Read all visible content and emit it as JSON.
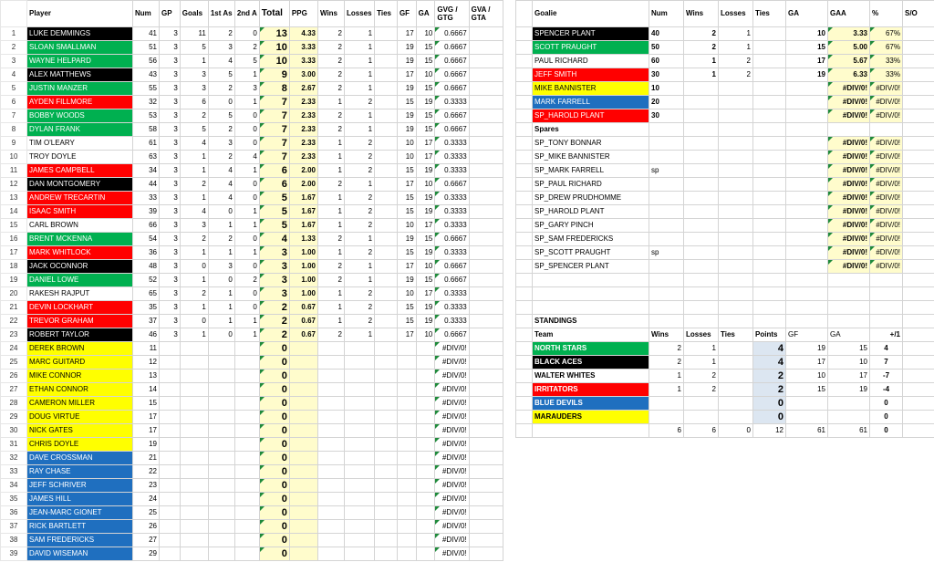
{
  "players": {
    "headers": [
      "Player",
      "Num",
      "GP",
      "Goals",
      "1st As",
      "2nd A",
      "Total",
      "PPG",
      "Wins",
      "Losses",
      "Ties",
      "GF",
      "GA",
      "GVG / GTG",
      "GVA / GTA"
    ],
    "rows": [
      {
        "n": "1",
        "name": "LUKE DEMMINGS",
        "team": "black",
        "num": "41",
        "gp": "3",
        "g": "11",
        "a1": "2",
        "a2": "0",
        "t": "13",
        "ppg": "4.33",
        "w": "2",
        "l": "1",
        "ti": "",
        "gf": "17",
        "ga": "10",
        "gvg": "0.6667"
      },
      {
        "n": "2",
        "name": "SLOAN SMALLMAN",
        "team": "green",
        "num": "51",
        "gp": "3",
        "g": "5",
        "a1": "3",
        "a2": "2",
        "t": "10",
        "ppg": "3.33",
        "w": "2",
        "l": "1",
        "ti": "",
        "gf": "19",
        "ga": "15",
        "gvg": "0.6667"
      },
      {
        "n": "3",
        "name": "WAYNE HELPARD",
        "team": "green",
        "num": "56",
        "gp": "3",
        "g": "1",
        "a1": "4",
        "a2": "5",
        "t": "10",
        "ppg": "3.33",
        "w": "2",
        "l": "1",
        "ti": "",
        "gf": "19",
        "ga": "15",
        "gvg": "0.6667"
      },
      {
        "n": "4",
        "name": "ALEX MATTHEWS",
        "team": "black",
        "num": "43",
        "gp": "3",
        "g": "3",
        "a1": "5",
        "a2": "1",
        "t": "9",
        "ppg": "3.00",
        "w": "2",
        "l": "1",
        "ti": "",
        "gf": "17",
        "ga": "10",
        "gvg": "0.6667"
      },
      {
        "n": "5",
        "name": "JUSTIN MANZER",
        "team": "green",
        "num": "55",
        "gp": "3",
        "g": "3",
        "a1": "2",
        "a2": "3",
        "t": "8",
        "ppg": "2.67",
        "w": "2",
        "l": "1",
        "ti": "",
        "gf": "19",
        "ga": "15",
        "gvg": "0.6667"
      },
      {
        "n": "6",
        "name": "AYDEN FILLMORE",
        "team": "red",
        "num": "32",
        "gp": "3",
        "g": "6",
        "a1": "0",
        "a2": "1",
        "t": "7",
        "ppg": "2.33",
        "w": "1",
        "l": "2",
        "ti": "",
        "gf": "15",
        "ga": "19",
        "gvg": "0.3333"
      },
      {
        "n": "7",
        "name": "BOBBY WOODS",
        "team": "green",
        "num": "53",
        "gp": "3",
        "g": "2",
        "a1": "5",
        "a2": "0",
        "t": "7",
        "ppg": "2.33",
        "w": "2",
        "l": "1",
        "ti": "",
        "gf": "19",
        "ga": "15",
        "gvg": "0.6667"
      },
      {
        "n": "8",
        "name": "DYLAN FRANK",
        "team": "green",
        "num": "58",
        "gp": "3",
        "g": "5",
        "a1": "2",
        "a2": "0",
        "t": "7",
        "ppg": "2.33",
        "w": "2",
        "l": "1",
        "ti": "",
        "gf": "19",
        "ga": "15",
        "gvg": "0.6667"
      },
      {
        "n": "9",
        "name": "TIM O'LEARY",
        "team": "white",
        "num": "61",
        "gp": "3",
        "g": "4",
        "a1": "3",
        "a2": "0",
        "t": "7",
        "ppg": "2.33",
        "w": "1",
        "l": "2",
        "ti": "",
        "gf": "10",
        "ga": "17",
        "gvg": "0.3333"
      },
      {
        "n": "10",
        "name": "TROY DOYLE",
        "team": "white",
        "num": "63",
        "gp": "3",
        "g": "1",
        "a1": "2",
        "a2": "4",
        "t": "7",
        "ppg": "2.33",
        "w": "1",
        "l": "2",
        "ti": "",
        "gf": "10",
        "ga": "17",
        "gvg": "0.3333"
      },
      {
        "n": "11",
        "name": "JAMES CAMPBELL",
        "team": "red",
        "num": "34",
        "gp": "3",
        "g": "1",
        "a1": "4",
        "a2": "1",
        "t": "6",
        "ppg": "2.00",
        "w": "1",
        "l": "2",
        "ti": "",
        "gf": "15",
        "ga": "19",
        "gvg": "0.3333"
      },
      {
        "n": "12",
        "name": "DAN MONTGOMERY",
        "team": "black",
        "num": "44",
        "gp": "3",
        "g": "2",
        "a1": "4",
        "a2": "0",
        "t": "6",
        "ppg": "2.00",
        "w": "2",
        "l": "1",
        "ti": "",
        "gf": "17",
        "ga": "10",
        "gvg": "0.6667"
      },
      {
        "n": "13",
        "name": "ANDREW TRECARTIN",
        "team": "red",
        "num": "33",
        "gp": "3",
        "g": "1",
        "a1": "4",
        "a2": "0",
        "t": "5",
        "ppg": "1.67",
        "w": "1",
        "l": "2",
        "ti": "",
        "gf": "15",
        "ga": "19",
        "gvg": "0.3333"
      },
      {
        "n": "14",
        "name": "ISAAC SMITH",
        "team": "red",
        "num": "39",
        "gp": "3",
        "g": "4",
        "a1": "0",
        "a2": "1",
        "t": "5",
        "ppg": "1.67",
        "w": "1",
        "l": "2",
        "ti": "",
        "gf": "15",
        "ga": "19",
        "gvg": "0.3333"
      },
      {
        "n": "15",
        "name": "CARL BROWN",
        "team": "white",
        "num": "66",
        "gp": "3",
        "g": "3",
        "a1": "1",
        "a2": "1",
        "t": "5",
        "ppg": "1.67",
        "w": "1",
        "l": "2",
        "ti": "",
        "gf": "10",
        "ga": "17",
        "gvg": "0.3333"
      },
      {
        "n": "16",
        "name": "BRENT MCKENNA",
        "team": "green",
        "num": "54",
        "gp": "3",
        "g": "2",
        "a1": "2",
        "a2": "0",
        "t": "4",
        "ppg": "1.33",
        "w": "2",
        "l": "1",
        "ti": "",
        "gf": "19",
        "ga": "15",
        "gvg": "0.6667"
      },
      {
        "n": "17",
        "name": "MARK WHITLOCK",
        "team": "red",
        "num": "36",
        "gp": "3",
        "g": "1",
        "a1": "1",
        "a2": "1",
        "t": "3",
        "ppg": "1.00",
        "w": "1",
        "l": "2",
        "ti": "",
        "gf": "15",
        "ga": "19",
        "gvg": "0.3333"
      },
      {
        "n": "18",
        "name": "JACK OCONNOR",
        "team": "black",
        "num": "48",
        "gp": "3",
        "g": "0",
        "a1": "3",
        "a2": "0",
        "t": "3",
        "ppg": "1.00",
        "w": "2",
        "l": "1",
        "ti": "",
        "gf": "17",
        "ga": "10",
        "gvg": "0.6667"
      },
      {
        "n": "19",
        "name": "DANIEL LOWE",
        "team": "green",
        "num": "52",
        "gp": "3",
        "g": "1",
        "a1": "0",
        "a2": "2",
        "t": "3",
        "ppg": "1.00",
        "w": "2",
        "l": "1",
        "ti": "",
        "gf": "19",
        "ga": "15",
        "gvg": "0.6667"
      },
      {
        "n": "20",
        "name": "RAKESH RAJPUT",
        "team": "white",
        "num": "65",
        "gp": "3",
        "g": "2",
        "a1": "1",
        "a2": "0",
        "t": "3",
        "ppg": "1.00",
        "w": "1",
        "l": "2",
        "ti": "",
        "gf": "10",
        "ga": "17",
        "gvg": "0.3333"
      },
      {
        "n": "21",
        "name": "DEVIN LOCKHART",
        "team": "red",
        "num": "35",
        "gp": "3",
        "g": "1",
        "a1": "1",
        "a2": "0",
        "t": "2",
        "ppg": "0.67",
        "w": "1",
        "l": "2",
        "ti": "",
        "gf": "15",
        "ga": "19",
        "gvg": "0.3333"
      },
      {
        "n": "22",
        "name": "TREVOR GRAHAM",
        "team": "red",
        "num": "37",
        "gp": "3",
        "g": "0",
        "a1": "1",
        "a2": "1",
        "t": "2",
        "ppg": "0.67",
        "w": "1",
        "l": "2",
        "ti": "",
        "gf": "15",
        "ga": "19",
        "gvg": "0.3333"
      },
      {
        "n": "23",
        "name": "ROBERT TAYLOR",
        "team": "black",
        "num": "46",
        "gp": "3",
        "g": "1",
        "a1": "0",
        "a2": "1",
        "t": "2",
        "ppg": "0.67",
        "w": "2",
        "l": "1",
        "ti": "",
        "gf": "17",
        "ga": "10",
        "gvg": "0.6667"
      },
      {
        "n": "24",
        "name": "DEREK BROWN",
        "team": "yellow",
        "num": "11",
        "gp": "",
        "g": "",
        "a1": "",
        "a2": "",
        "t": "0",
        "ppg": "",
        "w": "",
        "l": "",
        "ti": "",
        "gf": "",
        "ga": "",
        "gvg": "#DIV/0!"
      },
      {
        "n": "25",
        "name": "MARC GUITARD",
        "team": "yellow",
        "num": "12",
        "gp": "",
        "g": "",
        "a1": "",
        "a2": "",
        "t": "0",
        "ppg": "",
        "w": "",
        "l": "",
        "ti": "",
        "gf": "",
        "ga": "",
        "gvg": "#DIV/0!"
      },
      {
        "n": "26",
        "name": "MIKE CONNOR",
        "team": "yellow",
        "num": "13",
        "gp": "",
        "g": "",
        "a1": "",
        "a2": "",
        "t": "0",
        "ppg": "",
        "w": "",
        "l": "",
        "ti": "",
        "gf": "",
        "ga": "",
        "gvg": "#DIV/0!"
      },
      {
        "n": "27",
        "name": "ETHAN CONNOR",
        "team": "yellow",
        "num": "14",
        "gp": "",
        "g": "",
        "a1": "",
        "a2": "",
        "t": "0",
        "ppg": "",
        "w": "",
        "l": "",
        "ti": "",
        "gf": "",
        "ga": "",
        "gvg": "#DIV/0!"
      },
      {
        "n": "28",
        "name": "CAMERON MILLER",
        "team": "yellow",
        "num": "15",
        "gp": "",
        "g": "",
        "a1": "",
        "a2": "",
        "t": "0",
        "ppg": "",
        "w": "",
        "l": "",
        "ti": "",
        "gf": "",
        "ga": "",
        "gvg": "#DIV/0!"
      },
      {
        "n": "29",
        "name": "DOUG VIRTUE",
        "team": "yellow",
        "num": "17",
        "gp": "",
        "g": "",
        "a1": "",
        "a2": "",
        "t": "0",
        "ppg": "",
        "w": "",
        "l": "",
        "ti": "",
        "gf": "",
        "ga": "",
        "gvg": "#DIV/0!"
      },
      {
        "n": "30",
        "name": "NICK GATES",
        "team": "yellow",
        "num": "17",
        "gp": "",
        "g": "",
        "a1": "",
        "a2": "",
        "t": "0",
        "ppg": "",
        "w": "",
        "l": "",
        "ti": "",
        "gf": "",
        "ga": "",
        "gvg": "#DIV/0!"
      },
      {
        "n": "31",
        "name": "CHRIS DOYLE",
        "team": "yellow",
        "num": "19",
        "gp": "",
        "g": "",
        "a1": "",
        "a2": "",
        "t": "0",
        "ppg": "",
        "w": "",
        "l": "",
        "ti": "",
        "gf": "",
        "ga": "",
        "gvg": "#DIV/0!"
      },
      {
        "n": "32",
        "name": "DAVE CROSSMAN",
        "team": "blue",
        "num": "21",
        "gp": "",
        "g": "",
        "a1": "",
        "a2": "",
        "t": "0",
        "ppg": "",
        "w": "",
        "l": "",
        "ti": "",
        "gf": "",
        "ga": "",
        "gvg": "#DIV/0!"
      },
      {
        "n": "33",
        "name": "RAY CHASE",
        "team": "blue",
        "num": "22",
        "gp": "",
        "g": "",
        "a1": "",
        "a2": "",
        "t": "0",
        "ppg": "",
        "w": "",
        "l": "",
        "ti": "",
        "gf": "",
        "ga": "",
        "gvg": "#DIV/0!"
      },
      {
        "n": "34",
        "name": "JEFF SCHRIVER",
        "team": "blue",
        "num": "23",
        "gp": "",
        "g": "",
        "a1": "",
        "a2": "",
        "t": "0",
        "ppg": "",
        "w": "",
        "l": "",
        "ti": "",
        "gf": "",
        "ga": "",
        "gvg": "#DIV/0!"
      },
      {
        "n": "35",
        "name": "JAMES HILL",
        "team": "blue",
        "num": "24",
        "gp": "",
        "g": "",
        "a1": "",
        "a2": "",
        "t": "0",
        "ppg": "",
        "w": "",
        "l": "",
        "ti": "",
        "gf": "",
        "ga": "",
        "gvg": "#DIV/0!"
      },
      {
        "n": "36",
        "name": "JEAN-MARC GIONET",
        "team": "blue",
        "num": "25",
        "gp": "",
        "g": "",
        "a1": "",
        "a2": "",
        "t": "0",
        "ppg": "",
        "w": "",
        "l": "",
        "ti": "",
        "gf": "",
        "ga": "",
        "gvg": "#DIV/0!"
      },
      {
        "n": "37",
        "name": "RICK BARTLETT",
        "team": "blue",
        "num": "26",
        "gp": "",
        "g": "",
        "a1": "",
        "a2": "",
        "t": "0",
        "ppg": "",
        "w": "",
        "l": "",
        "ti": "",
        "gf": "",
        "ga": "",
        "gvg": "#DIV/0!"
      },
      {
        "n": "38",
        "name": "SAM FREDERICKS",
        "team": "blue",
        "num": "27",
        "gp": "",
        "g": "",
        "a1": "",
        "a2": "",
        "t": "0",
        "ppg": "",
        "w": "",
        "l": "",
        "ti": "",
        "gf": "",
        "ga": "",
        "gvg": "#DIV/0!"
      },
      {
        "n": "39",
        "name": "DAVID WISEMAN",
        "team": "blue",
        "num": "29",
        "gp": "",
        "g": "",
        "a1": "",
        "a2": "",
        "t": "0",
        "ppg": "",
        "w": "",
        "l": "",
        "ti": "",
        "gf": "",
        "ga": "",
        "gvg": "#DIV/0!"
      }
    ]
  },
  "goalies": {
    "headers": [
      "Goalie",
      "Num",
      "Wins",
      "Losses",
      "Ties",
      "GA",
      "GAA",
      "%",
      "S/O"
    ],
    "rows": [
      {
        "name": "SPENCER PLANT",
        "team": "black",
        "num": "40",
        "w": "2",
        "l": "1",
        "ti": "",
        "ga": "10",
        "gaa": "3.33",
        "pct": "67%",
        "so": ""
      },
      {
        "name": "SCOTT PRAUGHT",
        "team": "green",
        "num": "50",
        "w": "2",
        "l": "1",
        "ti": "",
        "ga": "15",
        "gaa": "5.00",
        "pct": "67%",
        "so": ""
      },
      {
        "name": "PAUL RICHARD",
        "team": "white",
        "num": "60",
        "w": "1",
        "l": "2",
        "ti": "",
        "ga": "17",
        "gaa": "5.67",
        "pct": "33%",
        "so": ""
      },
      {
        "name": "JEFF SMITH",
        "team": "red",
        "num": "30",
        "w": "1",
        "l": "2",
        "ti": "",
        "ga": "19",
        "gaa": "6.33",
        "pct": "33%",
        "so": ""
      },
      {
        "name": "MIKE BANNISTER",
        "team": "yellow",
        "num": "10",
        "w": "",
        "l": "",
        "ti": "",
        "ga": "",
        "gaa": "#DIV/0!",
        "pct": "#DIV/0!",
        "so": ""
      },
      {
        "name": "MARK FARRELL",
        "team": "blue",
        "num": "20",
        "w": "",
        "l": "",
        "ti": "",
        "ga": "",
        "gaa": "#DIV/0!",
        "pct": "#DIV/0!",
        "so": ""
      },
      {
        "name": "SP_HAROLD PLANT",
        "team": "red",
        "num": "30",
        "w": "",
        "l": "",
        "ti": "",
        "ga": "",
        "gaa": "#DIV/0!",
        "pct": "#DIV/0!",
        "so": ""
      }
    ],
    "spares_label": "Spares",
    "spares": [
      {
        "name": "SP_TONY BONNAR",
        "num": "",
        "gaa": "#DIV/0!",
        "pct": "#DIV/0!"
      },
      {
        "name": "SP_MIKE BANNISTER",
        "num": "",
        "gaa": "#DIV/0!",
        "pct": "#DIV/0!"
      },
      {
        "name": "SP_MARK FARRELL",
        "num": "sp",
        "gaa": "#DIV/0!",
        "pct": "#DIV/0!"
      },
      {
        "name": "SP_PAUL RICHARD",
        "num": "",
        "gaa": "#DIV/0!",
        "pct": "#DIV/0!"
      },
      {
        "name": "SP_DREW PRUDHOMME",
        "num": "",
        "gaa": "#DIV/0!",
        "pct": "#DIV/0!"
      },
      {
        "name": "SP_HAROLD PLANT",
        "num": "",
        "gaa": "#DIV/0!",
        "pct": "#DIV/0!"
      },
      {
        "name": "SP_GARY PINCH",
        "num": "",
        "gaa": "#DIV/0!",
        "pct": "#DIV/0!"
      },
      {
        "name": "SP_SAM FREDERICKS",
        "num": "",
        "gaa": "#DIV/0!",
        "pct": "#DIV/0!"
      },
      {
        "name": "SP_SCOTT PRAUGHT",
        "num": "sp",
        "gaa": "#DIV/0!",
        "pct": "#DIV/0!"
      },
      {
        "name": "SP_SPENCER PLANT",
        "num": "",
        "gaa": "#DIV/0!",
        "pct": "#DIV/0!"
      }
    ]
  },
  "standings": {
    "title": "STANDINGS",
    "headers": [
      "Team",
      "Wins",
      "Losses",
      "Ties",
      "Points",
      "GF",
      "GA",
      "+/1"
    ],
    "rows": [
      {
        "team": "NORTH STARS",
        "color": "green",
        "w": "2",
        "l": "1",
        "ti": "",
        "pts": "4",
        "gf": "19",
        "ga": "15",
        "diff": "4"
      },
      {
        "team": "BLACK ACES",
        "color": "black",
        "w": "2",
        "l": "1",
        "ti": "",
        "pts": "4",
        "gf": "17",
        "ga": "10",
        "diff": "7"
      },
      {
        "team": "WALTER WHITES",
        "color": "white",
        "w": "1",
        "l": "2",
        "ti": "",
        "pts": "2",
        "gf": "10",
        "ga": "17",
        "diff": "-7"
      },
      {
        "team": "IRRITATORS",
        "color": "red",
        "w": "1",
        "l": "2",
        "ti": "",
        "pts": "2",
        "gf": "15",
        "ga": "19",
        "diff": "-4"
      },
      {
        "team": "BLUE DEVILS",
        "color": "blue",
        "w": "",
        "l": "",
        "ti": "",
        "pts": "0",
        "gf": "",
        "ga": "",
        "diff": "0"
      },
      {
        "team": "MARAUDERS",
        "color": "yellow",
        "w": "",
        "l": "",
        "ti": "",
        "pts": "0",
        "gf": "",
        "ga": "",
        "diff": "0"
      }
    ],
    "totals": {
      "w": "6",
      "l": "6",
      "ti": "0",
      "pts": "12",
      "gf": "61",
      "ga": "61",
      "diff": "0"
    }
  },
  "colors": {
    "black": "#000000",
    "green": "#00b050",
    "red": "#ff0000",
    "blue": "#1f6fbf",
    "yellow": "#ffff00",
    "white": "#ffffff",
    "highlight": "#fffccc"
  }
}
